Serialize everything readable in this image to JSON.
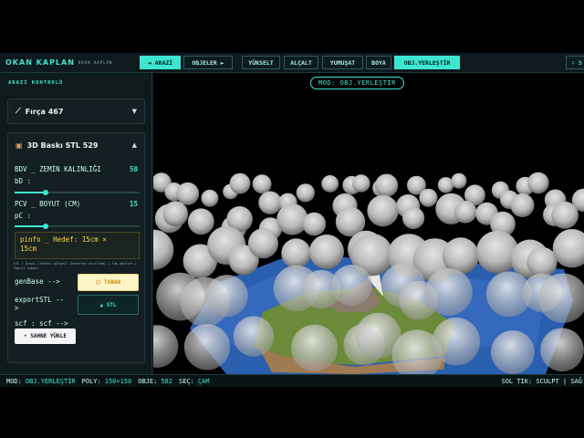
{
  "topbar": {
    "brand": "OKAN KAPLAN",
    "brand_sub": "OKAN KAPLAN",
    "btn_arazi": "◄ ARAZİ",
    "btn_objeler": "OBJELER ►",
    "tools": [
      "YÜKSELT",
      "ALÇALT",
      "YUMUŞAT",
      "BOYA",
      "OBJ.YERLEŞTİR"
    ],
    "right_btn": "⇩ S"
  },
  "side": {
    "title": "ARAZİ KONTROLÜ",
    "brush_card": {
      "label": "Fırça 467",
      "icon": "brush-icon"
    },
    "stl_card": {
      "label": "3D Baskı STL 529",
      "icon": "box-icon",
      "param1": {
        "label": "BDV _ ZEMİN KALINLIĞI",
        "value": "50",
        "sub": "bD :",
        "fraction": 0.25
      },
      "param2": {
        "label": "PCV _ BOYUT (CM)",
        "value": "15",
        "sub": "pC :",
        "fraction": 0.25
      },
      "info_line1": "pinfo _ Hedef: 15cm ×",
      "info_line2": "15cm",
      "tiny_text": "STL = Arazi + Renkli gölgeli (herorter tezilsem) + Tüm objeler + Yapılı tabanı",
      "genbase_label": "genBase -->",
      "genbase_btn": "⬡ TABAN",
      "export_label1": "exportSTL --",
      "export_label2": ">",
      "export_btn": "▲ STL",
      "scf_label": "scf : scf -->",
      "load_btn": "⇡ SAHNE YÜKLE"
    }
  },
  "viewport": {
    "mode_pill": "MOD: OBJ.YERLEŞTİR"
  },
  "status": {
    "mod_k": "MOD:",
    "mod_v": "OBJ.YERLEŞTİR",
    "poly_k": "POLY:",
    "poly_v": "150×150",
    "obje_k": "OBJE:",
    "obje_v": "582",
    "sec_k": "SEÇ:",
    "sec_v": "ÇAM",
    "right": "SOL TIK: SCULPT | SAĞ"
  },
  "colors": {
    "accent": "#3ee6d0",
    "warning": "#ffd54a",
    "water": "#2a5fb0"
  }
}
